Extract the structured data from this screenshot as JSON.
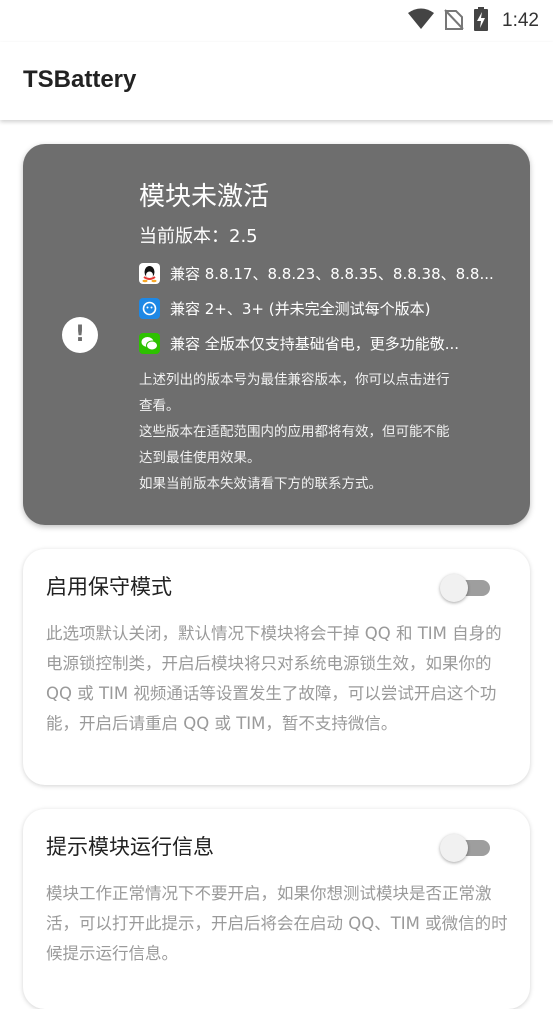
{
  "status_bar": {
    "time": "1:42"
  },
  "app": {
    "title": "TSBattery"
  },
  "status_card": {
    "title": "模块未激活",
    "version": "当前版本：2.5",
    "compat": [
      {
        "app_icon": "qq-icon",
        "text": "兼容 8.8.17、8.8.23、8.8.35、8.8.38、8.8..."
      },
      {
        "app_icon": "tim-icon",
        "text": "兼容 2+、3+ (并未完全测试每个版本)"
      },
      {
        "app_icon": "wechat-icon",
        "text": "兼容 全版本仅支持基础省电，更多功能敬..."
      }
    ],
    "note_lines": [
      "上述列出的版本号为最佳兼容版本，你可以点击进行",
      "查看。",
      "这些版本在适配范围内的应用都将有效，但可能不能",
      "达到最佳使用效果。",
      "如果当前版本失效请看下方的联系方式。"
    ]
  },
  "settings": [
    {
      "title": "启用保守模式",
      "enabled": false,
      "description": "此选项默认关闭，默认情况下模块将会干掉 QQ 和 TIM 自身的电源锁控制类，开启后模块将只对系统电源锁生效，如果你的 QQ 或 TIM 视频通话等设置发生了故障，可以尝试开启这个功能，开启后请重启 QQ 或 TIM，暂不支持微信。"
    },
    {
      "title": "提示模块运行信息",
      "enabled": false,
      "description": "模块工作正常情况下不要开启，如果你想测试模块是否正常激活，可以打开此提示，开启后将会在启动 QQ、TIM 或微信的时候提示运行信息。"
    }
  ],
  "colors": {
    "status_card_bg": "#6e6e6e",
    "tim_blue": "#1e88e5",
    "wechat_green": "#2dc100"
  }
}
